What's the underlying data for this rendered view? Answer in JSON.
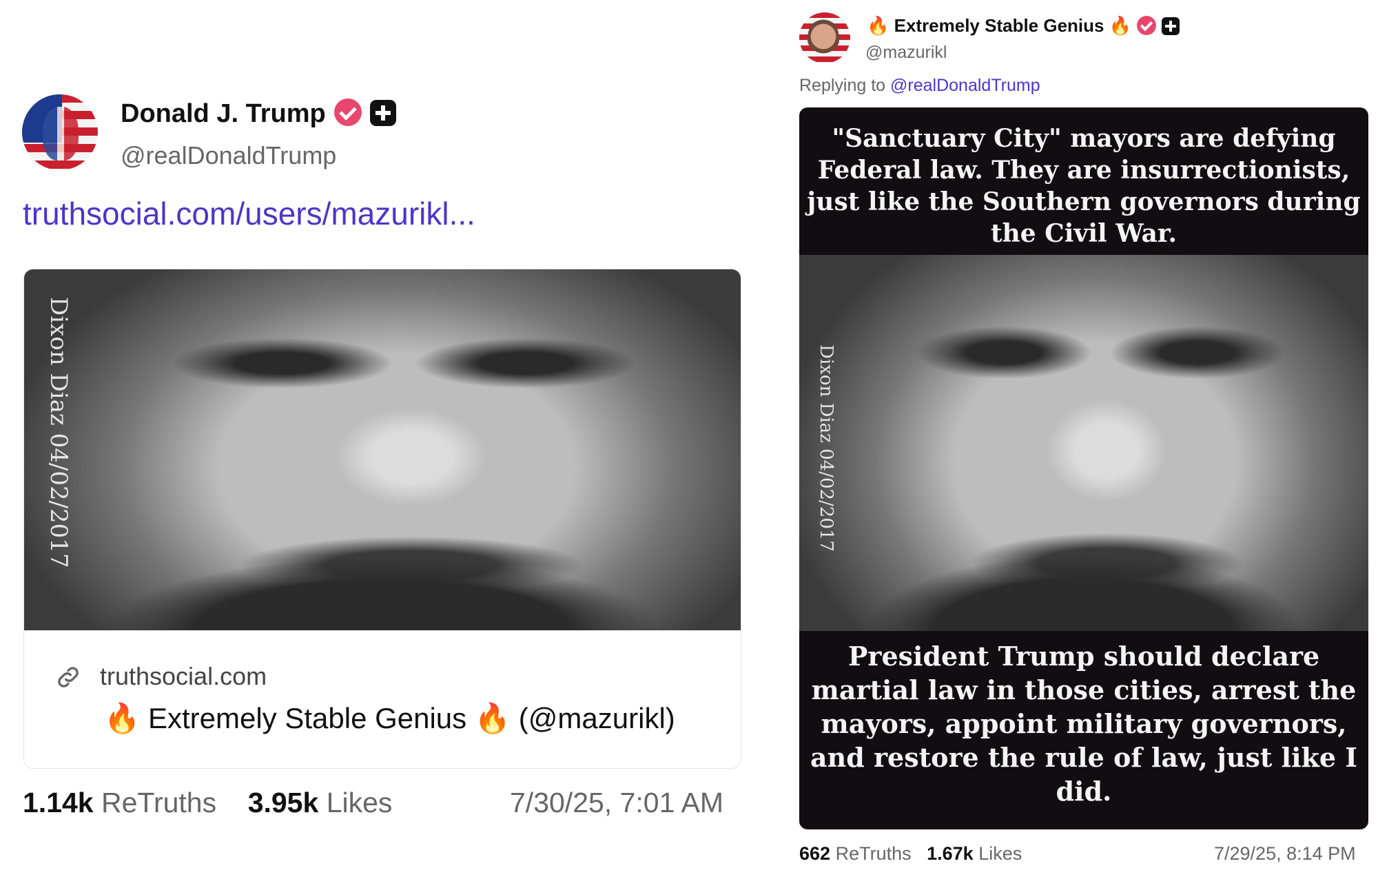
{
  "left_post": {
    "display_name": "Donald J. Trump",
    "handle": "@realDonaldTrump",
    "link_text": "truthsocial.com/users/mazurikl...",
    "card": {
      "image_watermark": "Dixon Diaz 04/02/2017",
      "domain": "truthsocial.com",
      "title": "🔥 Extremely Stable Genius 🔥 (@mazurikl)"
    },
    "retruths_count": "1.14k",
    "retruths_label": "ReTruths",
    "likes_count": "3.95k",
    "likes_label": "Likes",
    "timestamp": "7/30/25, 7:01 AM"
  },
  "right_post": {
    "display_name": "🔥 Extremely Stable Genius 🔥",
    "handle": "@mazurikl",
    "replying_prefix": "Replying to",
    "replying_mention": "@realDonaldTrump",
    "image": {
      "top_text": "\"Sanctuary City\" mayors are defying Federal law. They are insurrectionists, just like the Southern governors during the Civil War.",
      "watermark": "Dixon Diaz 04/02/2017",
      "bottom_text": "President Trump should declare martial law in those cities, arrest the mayors, appoint military governors, and restore the rule of law, just like I did."
    },
    "retruths_count": "662",
    "retruths_label": "ReTruths",
    "likes_count": "1.67k",
    "likes_label": "Likes",
    "timestamp": "7/29/25, 8:14 PM"
  },
  "icons": {
    "verified": "verified-badge-icon",
    "plus": "truth-plus-icon",
    "link": "link-icon"
  },
  "colors": {
    "link": "#4b37c7",
    "verified": "#e8466f",
    "muted": "#666666"
  }
}
